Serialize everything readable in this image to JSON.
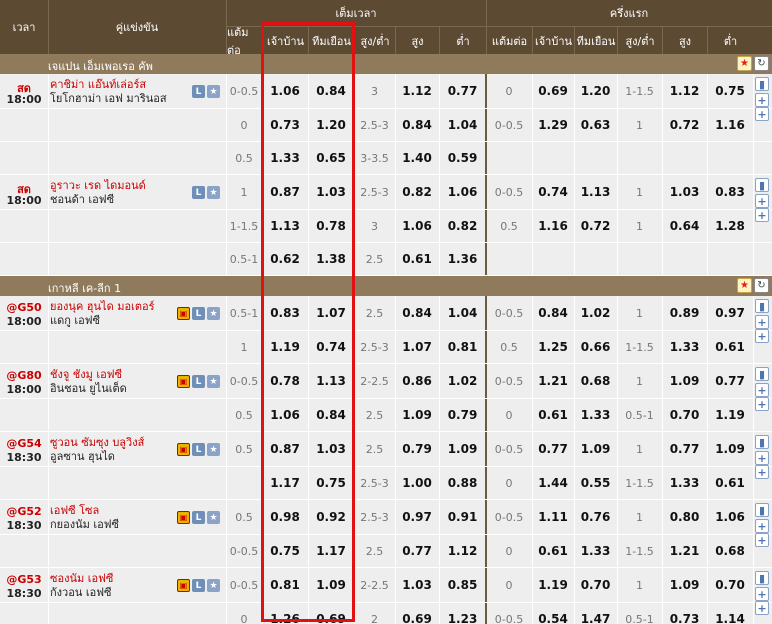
{
  "header": {
    "time": "เวลา",
    "match": "คู่แข่งขัน",
    "full_time": "เต็มเวลา",
    "first_half": "ครึ่งแรก",
    "cols": [
      "แต้มต่อ",
      "เจ้าบ้าน",
      "ทีมเยือน",
      "สูง/ต่ำ",
      "สูง",
      "ต่ำ",
      "แต้มต่อ",
      "เจ้าบ้าน",
      "ทีมเยือน",
      "สูง/ต่ำ",
      "สูง",
      "ต่ำ"
    ]
  },
  "leagues": [
    {
      "name": "เจแปน เอ็มเพอเรอ คัพ"
    },
    {
      "name": "เกาหลี เค-ลีก 1"
    }
  ],
  "matches": [
    {
      "status": "สด",
      "time": "18:00",
      "home": "คาชิม่า แอ๊นท์เล่อร์ส",
      "away": "โยโกฮาม่า เอฟ มารินอส",
      "rows": [
        [
          "0-0.5",
          "1.06",
          "0.84",
          "3",
          "1.12",
          "0.77",
          "0",
          "0.69",
          "1.20",
          "1-1.5",
          "1.12",
          "0.75"
        ],
        [
          "0",
          "0.73",
          "1.20",
          "2.5-3",
          "0.84",
          "1.04",
          "0-0.5",
          "1.29",
          "0.63",
          "1",
          "0.72",
          "1.16"
        ],
        [
          "0.5",
          "1.33",
          "0.65",
          "3-3.5",
          "1.40",
          "0.59",
          "",
          "",
          "",
          "",
          "",
          ""
        ]
      ]
    },
    {
      "status": "สด",
      "time": "18:00",
      "home": "อูราวะ เรด ไดมอนด์",
      "away": "ชอนด้า เอฟซี",
      "rows": [
        [
          "1",
          "0.87",
          "1.03",
          "2.5-3",
          "0.82",
          "1.06",
          "0-0.5",
          "0.74",
          "1.13",
          "1",
          "1.03",
          "0.83"
        ],
        [
          "1-1.5",
          "1.13",
          "0.78",
          "3",
          "1.06",
          "0.82",
          "0.5",
          "1.16",
          "0.72",
          "1",
          "0.64",
          "1.28"
        ],
        [
          "0.5-1",
          "0.62",
          "1.38",
          "2.5",
          "0.61",
          "1.36",
          "",
          "",
          "",
          "",
          "",
          ""
        ]
      ]
    },
    {
      "status": "@G50",
      "time": "18:00",
      "home": "ยองนุค ฮุนได มอเตอร์",
      "away": "แดกู เอฟซี",
      "rows": [
        [
          "0.5-1",
          "0.83",
          "1.07",
          "2.5",
          "0.84",
          "1.04",
          "0-0.5",
          "0.84",
          "1.02",
          "1",
          "0.89",
          "0.97"
        ],
        [
          "1",
          "1.19",
          "0.74",
          "2.5-3",
          "1.07",
          "0.81",
          "0.5",
          "1.25",
          "0.66",
          "1-1.5",
          "1.33",
          "0.61"
        ]
      ]
    },
    {
      "status": "@G80",
      "time": "18:00",
      "home": "ชังจู ชังมู เอฟซี",
      "away": "อินชอน ยูไนเต็ด",
      "rows": [
        [
          "0-0.5",
          "0.78",
          "1.13",
          "2-2.5",
          "0.86",
          "1.02",
          "0-0.5",
          "1.21",
          "0.68",
          "1",
          "1.09",
          "0.77"
        ],
        [
          "0.5",
          "1.06",
          "0.84",
          "2.5",
          "1.09",
          "0.79",
          "0",
          "0.61",
          "1.33",
          "0.5-1",
          "0.70",
          "1.19"
        ]
      ]
    },
    {
      "status": "@G54",
      "time": "18:30",
      "home": "ซูวอน ซัมซุง บลูวิงส์",
      "away": "อูลซาน ฮุนได",
      "rows": [
        [
          "0.5",
          "0.87",
          "1.03",
          "2.5",
          "0.79",
          "1.09",
          "0-0.5",
          "0.77",
          "1.09",
          "1",
          "0.77",
          "1.09"
        ],
        [
          "",
          "1.17",
          "0.75",
          "2.5-3",
          "1.00",
          "0.88",
          "0",
          "1.44",
          "0.55",
          "1-1.5",
          "1.33",
          "0.61"
        ]
      ]
    },
    {
      "status": "@G52",
      "time": "18:30",
      "home": "เอฟซี โซล",
      "away": "กยองนัม เอฟซี",
      "rows": [
        [
          "0.5",
          "0.98",
          "0.92",
          "2.5-3",
          "0.97",
          "0.91",
          "0-0.5",
          "1.11",
          "0.76",
          "1",
          "0.80",
          "1.06"
        ],
        [
          "0-0.5",
          "0.75",
          "1.17",
          "2.5",
          "0.77",
          "1.12",
          "0",
          "0.61",
          "1.33",
          "1-1.5",
          "1.21",
          "0.68"
        ]
      ]
    },
    {
      "status": "@G53",
      "time": "18:30",
      "home": "ซองนัม เอฟซี",
      "away": "กังวอน เอฟซี",
      "rows": [
        [
          "0-0.5",
          "0.81",
          "1.09",
          "2-2.5",
          "1.03",
          "0.85",
          "0",
          "1.19",
          "0.70",
          "1",
          "1.09",
          "0.70"
        ],
        [
          "0",
          "1.26",
          "0.69",
          "2",
          "0.69",
          "1.23",
          "0-0.5",
          "0.54",
          "1.47",
          "0.5-1",
          "0.73",
          "1.14"
        ]
      ]
    }
  ],
  "icons": {
    "l": "L",
    "star": "★",
    "tv": "▣",
    "plus": "+",
    "stats": "▮"
  }
}
